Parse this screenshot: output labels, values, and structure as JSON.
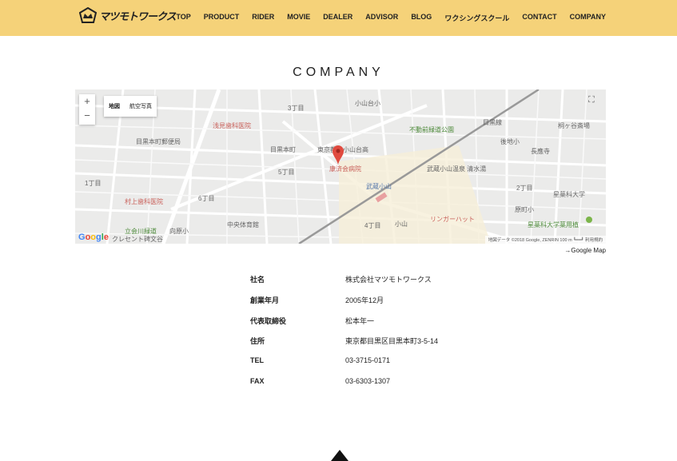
{
  "header": {
    "logo_text": "マツモトワークス",
    "nav": [
      "TOP",
      "PRODUCT",
      "RIDER",
      "MOVIE",
      "DEALER",
      "ADVISOR",
      "BLOG",
      "ワクシングスクール",
      "CONTACT",
      "COMPANY"
    ]
  },
  "page_title": "COMPANY",
  "map": {
    "zoom_in": "+",
    "zoom_out": "−",
    "type_map": "地図",
    "type_satellite": "航空写真",
    "labels": [
      {
        "t": "浅見歯科医院",
        "c": "red"
      },
      {
        "t": "目黒本町郵便局",
        "c": ""
      },
      {
        "t": "村上歯科医院",
        "c": "red"
      },
      {
        "t": "中央体育館",
        "c": ""
      },
      {
        "t": "立会川緑道",
        "c": "grn"
      },
      {
        "t": "向原小",
        "c": ""
      },
      {
        "t": "目黒本町",
        "c": ""
      },
      {
        "t": "6丁目",
        "c": ""
      },
      {
        "t": "5丁目",
        "c": ""
      },
      {
        "t": "1丁目",
        "c": ""
      },
      {
        "t": "小山台小",
        "c": ""
      },
      {
        "t": "3丁目",
        "c": ""
      },
      {
        "t": "東京都立小山台高",
        "c": ""
      },
      {
        "t": "不動前緑道公園",
        "c": "grn"
      },
      {
        "t": "目黒線",
        "c": ""
      },
      {
        "t": "後地小",
        "c": ""
      },
      {
        "t": "長應寺",
        "c": ""
      },
      {
        "t": "星薬科大学",
        "c": ""
      },
      {
        "t": "星薬科大学薬用植",
        "c": "grn"
      },
      {
        "t": "2丁目",
        "c": ""
      },
      {
        "t": "武蔵小山温泉 清水湯",
        "c": ""
      },
      {
        "t": "武蔵小山",
        "c": "blu"
      },
      {
        "t": "康済会病院",
        "c": "red"
      },
      {
        "t": "リンガーハット",
        "c": "red"
      },
      {
        "t": "小山",
        "c": ""
      },
      {
        "t": "4丁目",
        "c": ""
      },
      {
        "t": "原町小",
        "c": ""
      },
      {
        "t": "クレセント碑文谷",
        "c": ""
      },
      {
        "t": "桐ヶ谷斎場",
        "c": ""
      }
    ],
    "google": "Google",
    "footer": "地図データ ©2018 Google, ZENRIN   100 m ┗━━┛   利用規約",
    "link": "→Google Map"
  },
  "company": [
    {
      "k": "社名",
      "v": "株式会社マツモトワークス"
    },
    {
      "k": "創業年月",
      "v": "2005年12月"
    },
    {
      "k": "代表取締役",
      "v": "松本年一"
    },
    {
      "k": "住所",
      "v": "東京都目黒区目黒本町3-5-14"
    },
    {
      "k": "TEL",
      "v": "03-3715-0171"
    },
    {
      "k": "FAX",
      "v": "03-6303-1307"
    }
  ],
  "colors": {
    "header": "#f5d279",
    "marker": "#e04a3f"
  }
}
